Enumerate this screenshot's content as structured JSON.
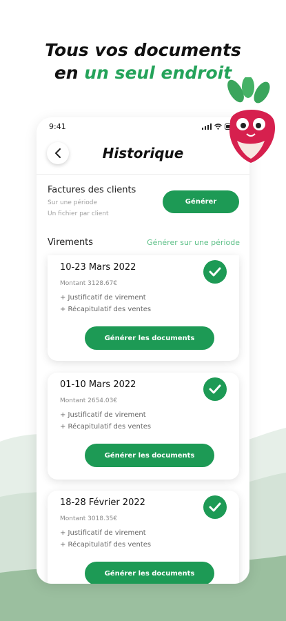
{
  "headline": {
    "line1": "Tous vos documents",
    "line2_prefix": "en ",
    "line2_accent": "un seul endroit"
  },
  "statusbar": {
    "time": "9:41"
  },
  "screen": {
    "title": "Historique"
  },
  "factures": {
    "title": "Factures des clients",
    "sub1": "Sur une période",
    "sub2": "Un fichier par client",
    "button": "Générer"
  },
  "virements": {
    "label": "Virements",
    "link": "Générer sur une période"
  },
  "cards": [
    {
      "date": "10-23 Mars 2022",
      "amount": "Montant 3128.67€",
      "line1": "+ Justificatif de virement",
      "line2": "+ Récapitulatif des ventes",
      "button": "Générer les documents"
    },
    {
      "date": "01-10 Mars 2022",
      "amount": "Montant 2654.03€",
      "line1": "+ Justificatif de virement",
      "line2": "+ Récapitulatif des ventes",
      "button": "Générer les documents"
    },
    {
      "date": "18-28 Février 2022",
      "amount": "Montant 3018.35€",
      "line1": "+ Justificatif de virement",
      "line2": "+ Récapitulatif des ventes",
      "button": "Générer les documents"
    }
  ],
  "colors": {
    "accent": "#1d9a55",
    "link": "#5bbf86",
    "radish": "#d6204e",
    "leaf": "#3aa55c"
  }
}
